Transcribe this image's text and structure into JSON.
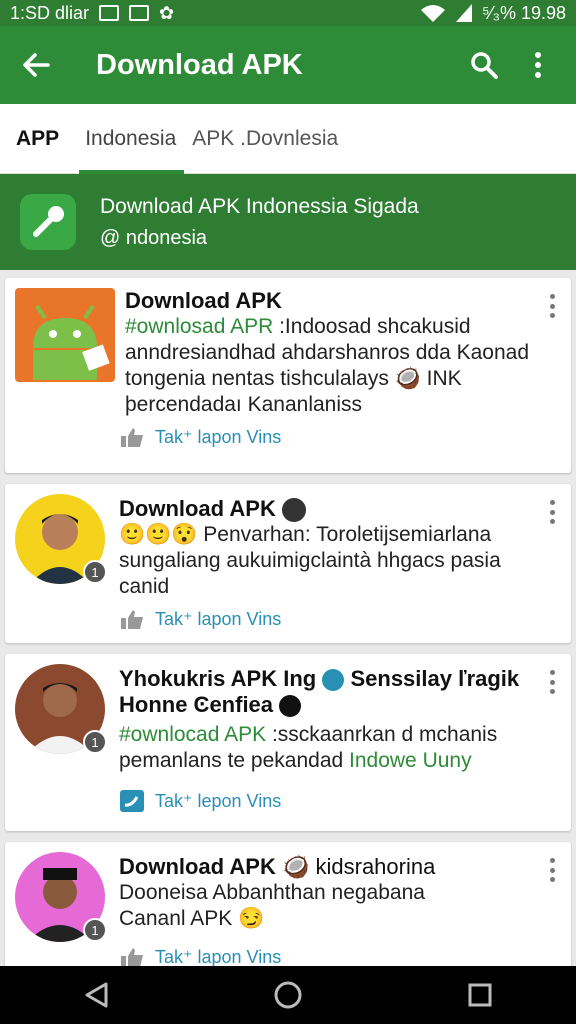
{
  "status_bar": {
    "left_text": "1:SD dliar",
    "right_text": "⁵⁄₃% 19.98"
  },
  "app_bar": {
    "title": "Download APK",
    "back_icon": "arrow-back-icon",
    "search_icon": "search-icon",
    "more_icon": "more-vert-icon"
  },
  "tabs": [
    {
      "label": "APP"
    },
    {
      "label": "Indonesia"
    },
    {
      "label": "APK .Dovnlesia"
    }
  ],
  "banner": {
    "title": "Download APK Indonessia Sigada",
    "subtitle": "@ ndonesia"
  },
  "cards": [
    {
      "title": "Download APK",
      "line1_green": "#ownlosad APR",
      "line1_rest": " :Indoosad shcakusid",
      "line2": "anndresiandhad ahdarshanros dda Kaonad",
      "line3": "tongenia nentas tishculalays 🥥 INK",
      "line4": "þercendadaı Kananlaniss",
      "action": "Tak⁺ lapon Vins"
    },
    {
      "title": "Download APK",
      "line1": "🙂🙂😯 Penvarhan: Toroletijsemiarlana",
      "line2": "sungaliang aukuimigclaintà hhgacs pasia",
      "line3": "canid",
      "action": "Tak⁺ lapon Vins",
      "badge": "1"
    },
    {
      "title": "Yhokukris APK Ing",
      "title_rest": "Senssilay ľragik",
      "title_line2": "Ηonne Ͼenfiea",
      "line1_green": "#ownlocad APK",
      "line1_rest": " :ssckaanrkan d mchanis",
      "line2": "pemanlans te pekandad",
      "line2_green": "Indowe Uuny",
      "action": "Tak⁺ lepon Vins",
      "badge": "1"
    },
    {
      "title": "Download APK",
      "title_rest": "🥥 kidsrahorina",
      "line1": "Dooneisa Abbanhthan negabana",
      "line2": "Cananl APK 😏",
      "action": "Tak⁺ lapon Vins",
      "badge": "1"
    }
  ],
  "colors": {
    "primary": "#2e8b37",
    "primary_dark": "#2e7d32",
    "link": "#2a8fb5"
  }
}
